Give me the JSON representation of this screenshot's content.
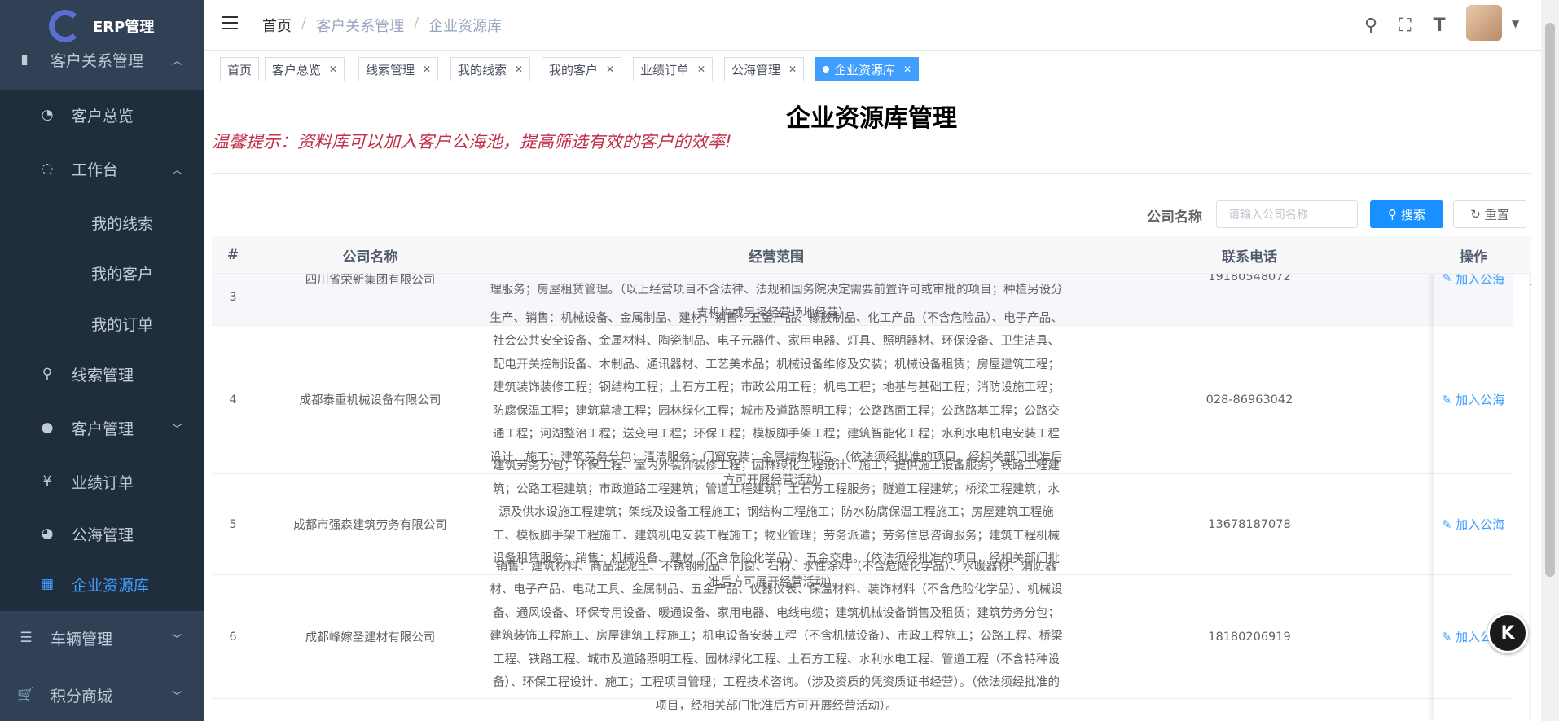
{
  "app": {
    "title": "ERP管理"
  },
  "sidebar": {
    "items": [
      {
        "label": "客户关系管理"
      },
      {
        "label": "客户总览"
      },
      {
        "label": "工作台"
      },
      {
        "label": "我的线索"
      },
      {
        "label": "我的客户"
      },
      {
        "label": "我的订单"
      },
      {
        "label": "线索管理"
      },
      {
        "label": "客户管理"
      },
      {
        "label": "业绩订单"
      },
      {
        "label": "公海管理"
      },
      {
        "label": "企业资源库"
      },
      {
        "label": "车辆管理"
      },
      {
        "label": "积分商城"
      }
    ]
  },
  "header": {
    "breadcrumb": [
      "首页",
      "客户关系管理",
      "企业资源库"
    ],
    "separator": "/"
  },
  "tags": [
    "首页",
    "客户总览",
    "线索管理",
    "我的线索",
    "我的客户",
    "业绩订单",
    "公海管理",
    "企业资源库"
  ],
  "main": {
    "title": "企业资源库管理",
    "tip": "温馨提示：资料库可以加入客户公海池，提高筛选有效的客户的效率!",
    "search": {
      "label": "公司名称",
      "placeholder": "请输入公司名称",
      "search_btn": "搜索",
      "reset_btn": "重置"
    }
  },
  "table": {
    "headers": [
      "#",
      "公司名称",
      "经营范围",
      "联系电话",
      "操作"
    ],
    "op_label": "加入公海",
    "rows": [
      {
        "idx": "3",
        "company": "四川省荣新集团有限公司",
        "scope": "油、生丝、蚕茧和其他有专项规定的项目）；建筑机械设备租赁；苗木种植；室内外装饰装修（凭资质许可证经营）；设计、制作、发布、代理国内各类广告（不含气球广告）；组织、策划文化交流活动；清洁服务；市场管理服务；房屋租赁管理。（以上经营项目不含法律、法规和国务院决定需要前置许可或审批的项目；种植另设分支机构或另择经营场地经营）。",
        "phone": "19180548072"
      },
      {
        "idx": "4",
        "company": "成都泰重机械设备有限公司",
        "scope": "生产、销售：机械设备、金属制品、建材；销售：五金产品、橡胶制品、化工产品（不含危险品）、电子产品、社会公共安全设备、金属材料、陶瓷制品、电子元器件、家用电器、灯具、照明器材、环保设备、卫生洁具、配电开关控制设备、木制品、通讯器材、工艺美术品；机械设备维修及安装；机械设备租赁；房屋建筑工程；建筑装饰装修工程；钢结构工程；土石方工程；市政公用工程；机电工程；地基与基础工程；消防设施工程；防腐保温工程；建筑幕墙工程；园林绿化工程；城市及道路照明工程；公路路面工程；公路路基工程；公路交通工程；河湖整治工程；送变电工程；环保工程；模板脚手架工程；建筑智能化工程；水利水电机电安装工程设计、施工；建筑劳务分包；清洁服务；门窗安装；金属结构制造。（依法须经批准的项目，经相关部门批准后方可开展经营活动）",
        "phone": "028-86963042"
      },
      {
        "idx": "5",
        "company": "成都市强森建筑劳务有限公司",
        "scope": "建筑劳务分包；环保工程、室内外装饰装修工程；园林绿化工程设计、施工；提供施工设备服务；铁路工程建筑；公路工程建筑；市政道路工程建筑；管道工程建筑；土石方工程服务；隧道工程建筑；桥梁工程建筑；水源及供水设施工程建筑；架线及设备工程施工；钢结构工程施工；防水防腐保温工程施工；房屋建筑工程施工、模板脚手架工程施工、建筑机电安装工程施工；物业管理；劳务派遣；劳务信息咨询服务；建筑工程机械设备租赁服务；销售：机械设备、建材（不含危险化学品）、五金交电。（依法须经批准的项目，经相关部门批准后方可展开经营活动）。",
        "phone": "13678187078"
      },
      {
        "idx": "6",
        "company": "成都峰嫁圣建材有限公司",
        "scope": "销售：建筑材料、商品混泥土、不锈钢制品、门窗、石材、水性涂料（不含危险化学品）、水暖器材、消防器材、电子产品、电动工具、金属制品、五金产品、仪器仪表、保温材料、装饰材料（不含危险化学品）、机械设备、通风设备、环保专用设备、暖通设备、家用电器、电线电缆；建筑机械设备销售及租赁；建筑劳务分包；建筑装饰工程施工、房屋建筑工程施工；机电设备安装工程（不含机械设备）、市政工程施工；公路工程、桥梁工程、铁路工程、城市及道路照明工程、园林绿化工程、土石方工程、水利水电工程、管道工程（不含特种设备）、环保工程设计、施工；工程项目管理；工程技术咨询。（涉及资质的凭资质证书经营）。（依法须经批准的项目，经相关部门批准后方可开展经营活动）。",
        "phone": "18180206919"
      }
    ]
  },
  "colors": {
    "sidebar_bg": "#304156",
    "sidebar_active": "#409eff",
    "primary": "#1890ff",
    "tip": "#c0304a"
  },
  "fab": {
    "label": "K"
  }
}
